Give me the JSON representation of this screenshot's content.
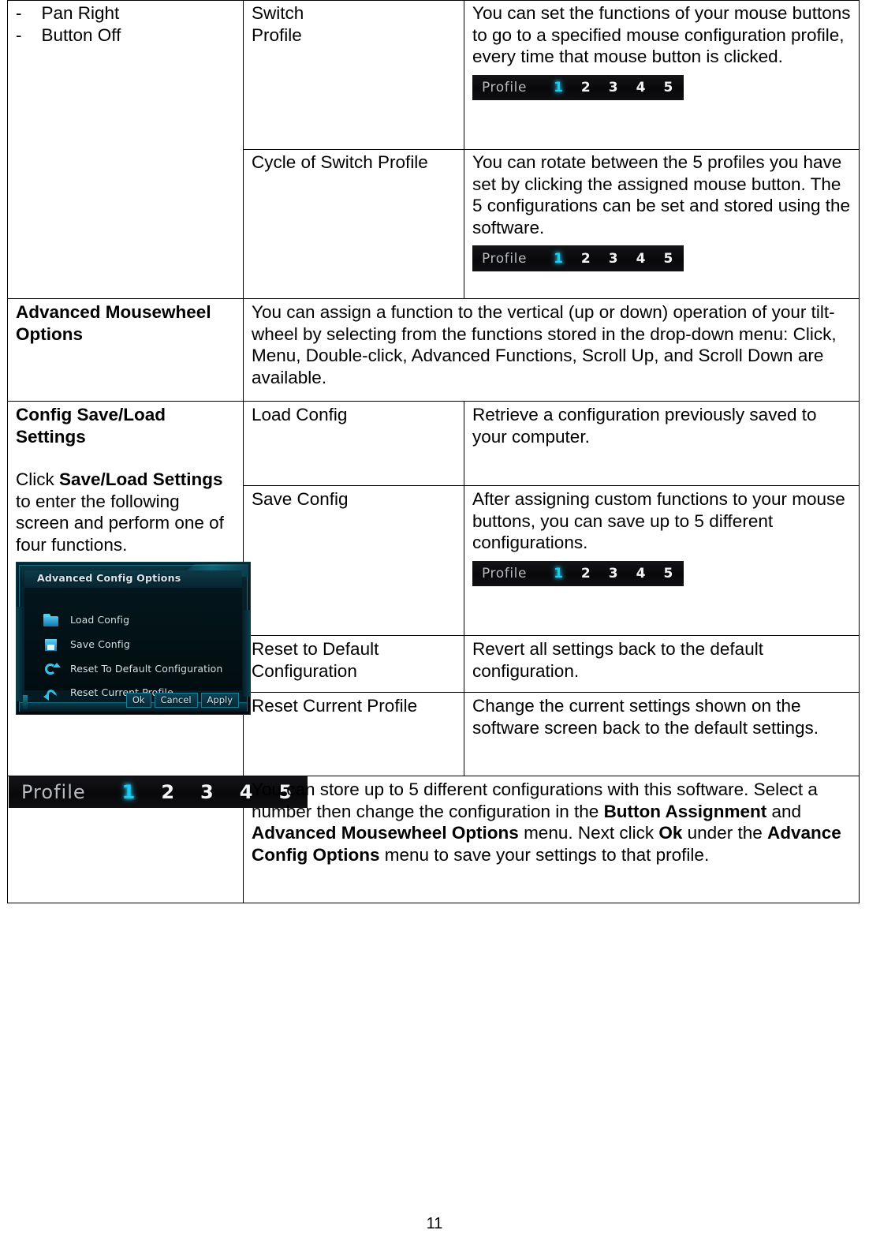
{
  "document": {
    "page_number": "11"
  },
  "profile_widget": {
    "label": "Profile",
    "numbers": [
      "1",
      "2",
      "3",
      "4",
      "5"
    ],
    "active_index": 0,
    "active_color": "#18cdf0",
    "background_color": "#0a0a0c",
    "label_color": "#b9bcc0"
  },
  "advanced_config_dialog": {
    "title": "Advanced Config Options",
    "items": [
      {
        "label": "Load Config",
        "icon": "folder-icon"
      },
      {
        "label": "Save Config",
        "icon": "floppy-disk-icon"
      },
      {
        "label": "Reset To Default Configuration",
        "icon": "refresh-icon"
      },
      {
        "label": "Reset Current Profile",
        "icon": "undo-arrow-icon"
      }
    ],
    "buttons": [
      "Ok",
      "Cancel",
      "Apply"
    ],
    "accent_color": "#33c6ef",
    "background_color": "#04161c"
  },
  "table": {
    "button_list": {
      "items": [
        "-    Pan Right",
        "-    Button Off"
      ]
    },
    "switch_profile": {
      "name_line1": "Switch",
      "name_line2": "Profile",
      "description": "You can set the functions of your mouse buttons to go to a specified mouse configuration profile, every time that mouse button is clicked."
    },
    "cycle_switch_profile": {
      "name": "Cycle of Switch Profile",
      "description": "You can rotate between the 5 profiles you have set by clicking the assigned mouse button. The 5 configurations can be set and stored using the software."
    },
    "advanced_mousewheel": {
      "title_line1": "Advanced Mousewheel",
      "title_line2": "Options",
      "description": "You can assign a function to the vertical (up or down) operation of your tilt-wheel by selecting from the functions stored in the drop-down menu: Click, Menu, Double-click, Advanced Functions, Scroll Up, and Scroll Down are available."
    },
    "config_save_load": {
      "title_line1": "Config Save/Load",
      "title_line2": "Settings",
      "intro_pre": "Click ",
      "intro_bold": "Save/Load Settings",
      "intro_post": " to enter the following screen and perform one of four functions.",
      "rows": [
        {
          "name": "Load Config",
          "description": "Retrieve a configuration previously saved to your computer."
        },
        {
          "name": "Save Config",
          "description": "After assigning custom functions to your mouse buttons, you can save up to 5 different configurations."
        },
        {
          "name": "Reset to Default Configuration",
          "description": "Revert all settings back to the default configuration."
        },
        {
          "name": "Reset Current Profile",
          "description": "Change the current settings shown on the software screen back to the default settings."
        }
      ]
    },
    "profile_row": {
      "text_1": "You can store up to 5 different configurations with this software. Select a number then change the configuration in the ",
      "bold_1": "Button Assignment",
      "text_2": " and ",
      "bold_2": "Advanced Mousewheel Options",
      "text_3": " menu. Next click ",
      "bold_3": "Ok",
      "text_4": " under the ",
      "bold_4": "Advance Config Options",
      "text_5": " menu to save your settings to that profile."
    }
  }
}
